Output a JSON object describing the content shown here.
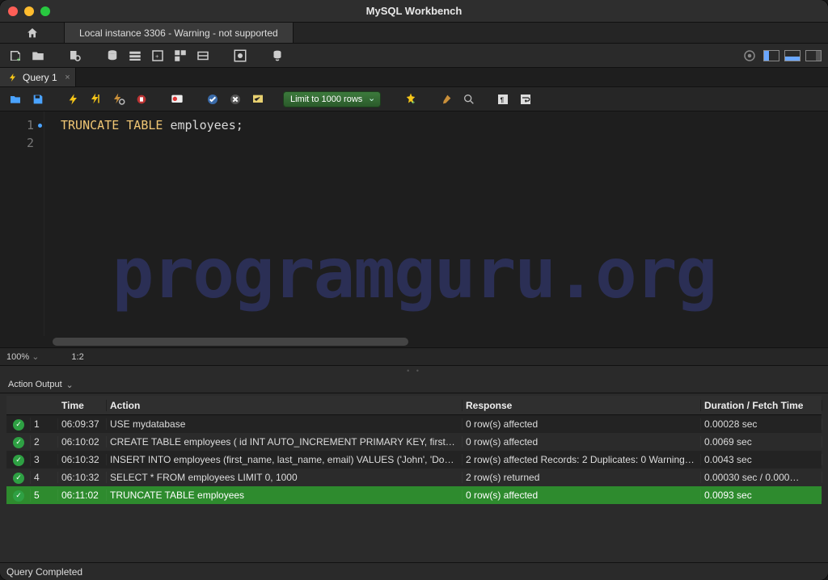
{
  "window": {
    "title": "MySQL Workbench"
  },
  "connection_tab": "Local instance 3306 - Warning - not supported",
  "query_tab": {
    "label": "Query 1"
  },
  "limit_dropdown": "Limit to 1000 rows",
  "editor": {
    "line1_kw": "TRUNCATE TABLE",
    "line1_rest": " employees;",
    "lineno1": "1",
    "lineno2": "2"
  },
  "editor_status": {
    "zoom": "100%",
    "cursor": "1:2"
  },
  "watermark": "programguru.org",
  "output_dropdown": "Action Output",
  "output_columns": {
    "blank": "",
    "num": "",
    "time": "Time",
    "action": "Action",
    "response": "Response",
    "duration": "Duration / Fetch Time"
  },
  "output_rows": [
    {
      "n": "1",
      "time": "06:09:37",
      "action": "USE mydatabase",
      "response": "0 row(s) affected",
      "duration": "0.00028 sec"
    },
    {
      "n": "2",
      "time": "06:10:02",
      "action": "CREATE TABLE employees (     id INT AUTO_INCREMENT PRIMARY KEY,     first_n…",
      "response": "0 row(s) affected",
      "duration": "0.0069 sec"
    },
    {
      "n": "3",
      "time": "06:10:32",
      "action": "INSERT INTO employees (first_name, last_name, email) VALUES ('John', 'Doe', 'jo…",
      "response": "2 row(s) affected Records: 2  Duplicates: 0  Warnings…",
      "duration": "0.0043 sec"
    },
    {
      "n": "4",
      "time": "06:10:32",
      "action": "SELECT * FROM employees LIMIT 0, 1000",
      "response": "2 row(s) returned",
      "duration": "0.00030 sec / 0.000…"
    },
    {
      "n": "5",
      "time": "06:11:02",
      "action": "TRUNCATE TABLE employees",
      "response": "0 row(s) affected",
      "duration": "0.0093 sec"
    }
  ],
  "status_bar": "Query Completed"
}
